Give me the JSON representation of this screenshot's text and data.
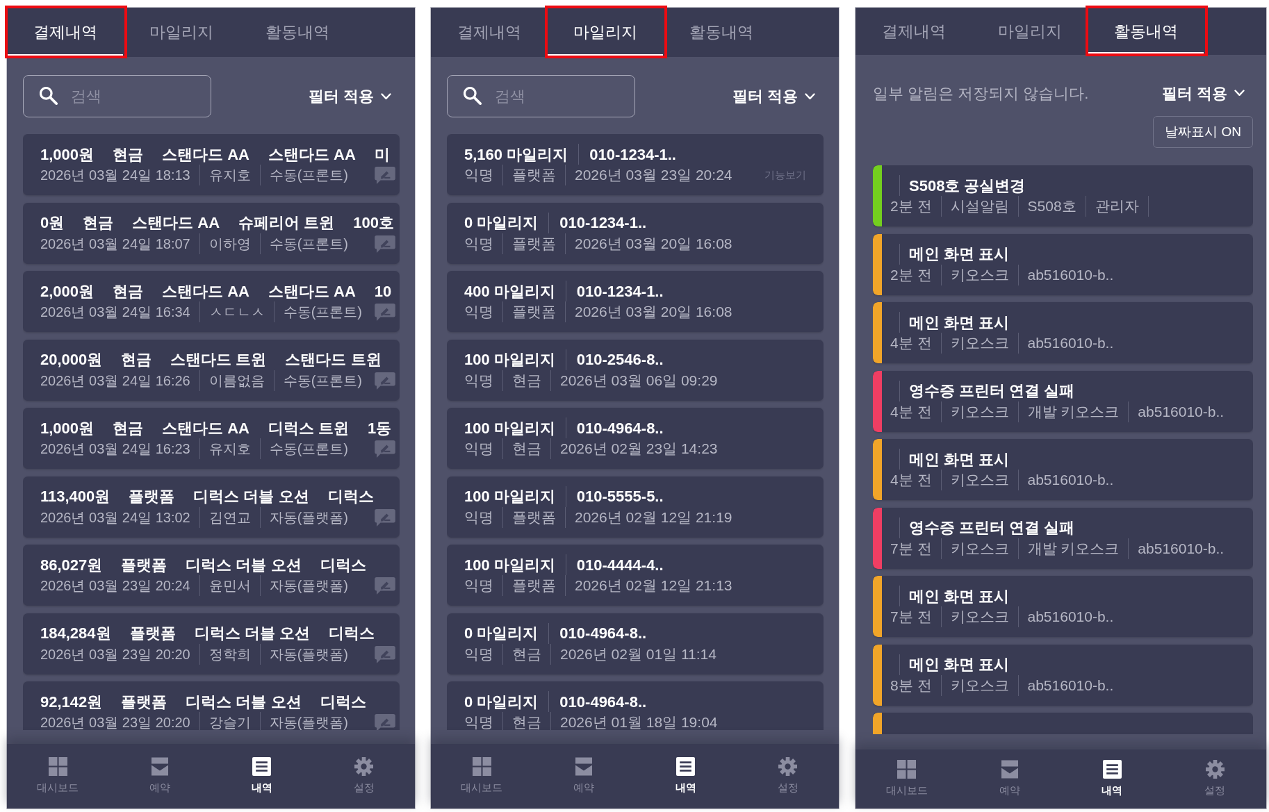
{
  "panels": [
    {
      "kind": "payments",
      "tabs": [
        {
          "label": "결제내역",
          "selected": true,
          "highlighted": true
        },
        {
          "label": "마일리지",
          "selected": false,
          "highlighted": false
        },
        {
          "label": "활동내역",
          "selected": false,
          "highlighted": false
        }
      ],
      "search": {
        "placeholder": "검색"
      },
      "filter": {
        "label": "필터 적용"
      },
      "items": [
        {
          "fields": [
            "1,000원",
            "현금",
            "스탠다드 AA",
            "스탠다드 AA",
            "미"
          ],
          "details": [
            "2026년 03월 24일 18:13",
            "유지호",
            "수동(프론트)"
          ]
        },
        {
          "fields": [
            "0원",
            "현금",
            "스탠다드 AA",
            "슈페리어 트윈",
            "100호"
          ],
          "details": [
            "2026년 03월 24일 18:07",
            "이하영",
            "수동(프론트)"
          ]
        },
        {
          "fields": [
            "2,000원",
            "현금",
            "스탠다드 AA",
            "스탠다드 AA",
            "10"
          ],
          "details": [
            "2026년 03월 24일 16:34",
            "ㅅㄷㄴㅅ",
            "수동(프론트)"
          ]
        },
        {
          "fields": [
            "20,000원",
            "현금",
            "스탠다드 트윈",
            "스탠다드 트윈"
          ],
          "details": [
            "2026년 03월 24일 16:26",
            "이름없음",
            "수동(프론트)"
          ]
        },
        {
          "fields": [
            "1,000원",
            "현금",
            "스탠다드 AA",
            "디럭스 트윈",
            "1동"
          ],
          "details": [
            "2026년 03월 24일 16:23",
            "유지호",
            "수동(프론트)"
          ]
        },
        {
          "fields": [
            "113,400원",
            "플랫폼",
            "디럭스 더블 오션",
            "디럭스"
          ],
          "details": [
            "2026년 03월 24일 13:02",
            "김연교",
            "자동(플랫폼)"
          ]
        },
        {
          "fields": [
            "86,027원",
            "플랫폼",
            "디럭스 더블 오션",
            "디럭스"
          ],
          "details": [
            "2026년 03월 23일 20:24",
            "윤민서",
            "자동(플랫폼)"
          ]
        },
        {
          "fields": [
            "184,284원",
            "플랫폼",
            "디럭스 더블 오션",
            "디럭스"
          ],
          "details": [
            "2026년 03월 23일 20:20",
            "정학희",
            "자동(플랫폼)"
          ]
        },
        {
          "fields": [
            "92,142원",
            "플랫폼",
            "디럭스 더블 오션",
            "디럭스"
          ],
          "details": [
            "2026년 03월 23일 20:20",
            "강슬기",
            "자동(플랫폼)"
          ]
        }
      ],
      "bottom_nav": [
        {
          "label": "대시보드",
          "kind": "dashboard",
          "selected": false
        },
        {
          "label": "예약",
          "kind": "reservation",
          "selected": false
        },
        {
          "label": "내역",
          "kind": "history",
          "selected": true
        },
        {
          "label": "설정",
          "kind": "settings",
          "selected": false
        }
      ]
    },
    {
      "kind": "mileage",
      "tabs": [
        {
          "label": "결제내역",
          "selected": false,
          "highlighted": false
        },
        {
          "label": "마일리지",
          "selected": true,
          "highlighted": true
        },
        {
          "label": "활동내역",
          "selected": false,
          "highlighted": false
        }
      ],
      "search": {
        "placeholder": "검색"
      },
      "filter": {
        "label": "필터 적용"
      },
      "items": [
        {
          "fields": [
            "5,160 마일리지",
            "010-1234-1.."
          ],
          "details": [
            "익명",
            "플랫폼",
            "2026년 03월 23일 20:24"
          ],
          "action": "기능보기"
        },
        {
          "fields": [
            "0 마일리지",
            "010-1234-1.."
          ],
          "details": [
            "익명",
            "플랫폼",
            "2026년 03월 20일 16:08"
          ]
        },
        {
          "fields": [
            "400 마일리지",
            "010-1234-1.."
          ],
          "details": [
            "익명",
            "플랫폼",
            "2026년 03월 20일 16:08"
          ]
        },
        {
          "fields": [
            "100 마일리지",
            "010-2546-8.."
          ],
          "details": [
            "익명",
            "현금",
            "2026년 03월 06일 09:29"
          ]
        },
        {
          "fields": [
            "100 마일리지",
            "010-4964-8.."
          ],
          "details": [
            "익명",
            "현금",
            "2026년 02월 23일 14:23"
          ]
        },
        {
          "fields": [
            "100 마일리지",
            "010-5555-5.."
          ],
          "details": [
            "익명",
            "플랫폼",
            "2026년 02월 12일 21:19"
          ]
        },
        {
          "fields": [
            "100 마일리지",
            "010-4444-4.."
          ],
          "details": [
            "익명",
            "플랫폼",
            "2026년 02월 12일 21:13"
          ]
        },
        {
          "fields": [
            "0 마일리지",
            "010-4964-8.."
          ],
          "details": [
            "익명",
            "현금",
            "2026년 02월 01일 11:14"
          ]
        },
        {
          "fields": [
            "0 마일리지",
            "010-4964-8.."
          ],
          "details": [
            "익명",
            "현금",
            "2026년 01월 18일 19:04"
          ]
        }
      ],
      "bottom_nav": [
        {
          "label": "대시보드",
          "kind": "dashboard",
          "selected": false
        },
        {
          "label": "예약",
          "kind": "reservation",
          "selected": false
        },
        {
          "label": "내역",
          "kind": "history",
          "selected": true
        },
        {
          "label": "설정",
          "kind": "settings",
          "selected": false
        }
      ]
    },
    {
      "kind": "activity",
      "tabs": [
        {
          "label": "결제내역",
          "selected": false,
          "highlighted": false
        },
        {
          "label": "마일리지",
          "selected": false,
          "highlighted": false
        },
        {
          "label": "활동내역",
          "selected": true,
          "highlighted": true
        }
      ],
      "notice": "일부 알림은 저장되지 않습니다.",
      "filter": {
        "label": "필터 적용"
      },
      "date_toggle": {
        "label": "날짜표시 ON"
      },
      "items": [
        {
          "color": "#74cf1f",
          "title": "S508호 공실변경",
          "details": [
            "2분 전",
            "시설알림",
            "S508호",
            "관리자"
          ],
          "trailing_divider": true
        },
        {
          "color": "#f1a529",
          "title": "메인 화면 표시",
          "details": [
            "2분 전",
            "키오스크",
            "ab516010-b.."
          ],
          "trailing_divider": false
        },
        {
          "color": "#f1a529",
          "title": "메인 화면 표시",
          "details": [
            "4분 전",
            "키오스크",
            "ab516010-b.."
          ],
          "trailing_divider": false
        },
        {
          "color": "#ef3e63",
          "title": "영수증 프린터 연결 실패",
          "details": [
            "4분 전",
            "키오스크",
            "개발 키오스크",
            "ab516010-b.."
          ],
          "trailing_divider": false
        },
        {
          "color": "#f1a529",
          "title": "메인 화면 표시",
          "details": [
            "4분 전",
            "키오스크",
            "ab516010-b.."
          ],
          "trailing_divider": false
        },
        {
          "color": "#ef3e63",
          "title": "영수증 프린터 연결 실패",
          "details": [
            "7분 전",
            "키오스크",
            "개발 키오스크",
            "ab516010-b.."
          ],
          "trailing_divider": false
        },
        {
          "color": "#f1a529",
          "title": "메인 화면 표시",
          "details": [
            "7분 전",
            "키오스크",
            "ab516010-b.."
          ],
          "trailing_divider": false
        },
        {
          "color": "#f1a529",
          "title": "메인 화면 표시",
          "details": [
            "8분 전",
            "키오스크",
            "ab516010-b.."
          ],
          "trailing_divider": false
        },
        {
          "color": "#f1a529"
        }
      ],
      "bottom_nav": [
        {
          "label": "대시보드",
          "kind": "dashboard",
          "selected": false
        },
        {
          "label": "예약",
          "kind": "reservation",
          "selected": false
        },
        {
          "label": "내역",
          "kind": "history",
          "selected": true
        },
        {
          "label": "설정",
          "kind": "settings",
          "selected": false
        }
      ]
    }
  ]
}
